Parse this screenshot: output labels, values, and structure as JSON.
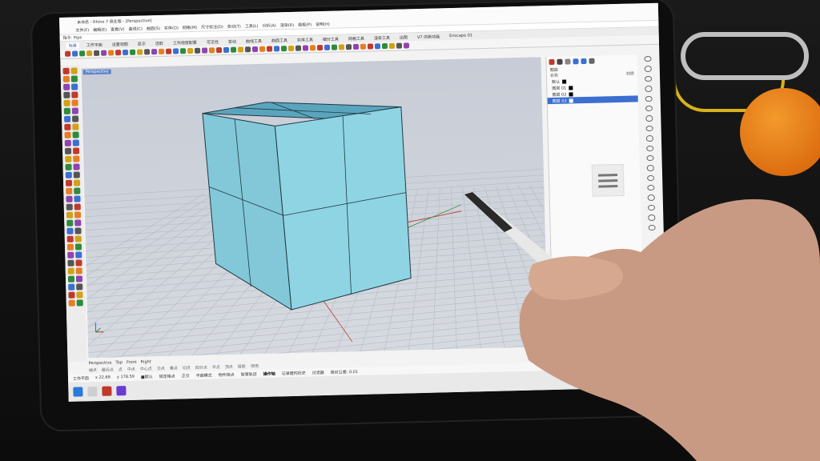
{
  "window_title": "未命名 - Rhino 7 商业版 - [Perspective]",
  "menu_items": [
    "文件(F)",
    "编辑(E)",
    "查看(V)",
    "曲线(C)",
    "曲面(S)",
    "实体(O)",
    "网格(M)",
    "尺寸标注(D)",
    "变动(T)",
    "工具(L)",
    "分析(A)",
    "渲染(R)",
    "面板(P)",
    "说明(H)"
  ],
  "command_line": "指令: Pipe",
  "tabs": [
    "标准",
    "工作平面",
    "设置视图",
    "显示",
    "选取",
    "工作视窗配置",
    "可见性",
    "变动",
    "曲线工具",
    "曲面工具",
    "实体工具",
    "细分工具",
    "网格工具",
    "渲染工具",
    "出图",
    "V7 的新功能",
    "Enscape 01"
  ],
  "active_tab_index": 0,
  "viewport_label": "Perspective",
  "view_tabs": [
    "Perspective",
    "Top",
    "Front",
    "Right"
  ],
  "osnap_items": [
    "端点",
    "最近点",
    "点",
    "中点",
    "中心点",
    "交点",
    "垂点",
    "切点",
    "四分点",
    "节点",
    "顶点",
    "投影",
    "停用"
  ],
  "status": {
    "cplane": "工作平面",
    "x": "x 22.68",
    "y": "y 178.59",
    "layer": "■默认",
    "items": [
      "锁定格点",
      "正交",
      "平面模式",
      "物件锁点",
      "智慧轨迹",
      "操作轴",
      "记录建构历史",
      "过滤器",
      "绝对公差: 0.01"
    ],
    "active_index": 5
  },
  "layers_panel": {
    "title": "图层",
    "header_name": "名称",
    "header_material": "材质",
    "rows": [
      {
        "name": "默认",
        "selected": false
      },
      {
        "name": "图层 01",
        "selected": false
      },
      {
        "name": "图层 02",
        "selected": false
      },
      {
        "name": "图层 03",
        "selected": true
      }
    ]
  },
  "colors": {
    "cube": "#8ed3e2",
    "cube_dark": "#6fb8c9",
    "cube_edge": "#1e3a45",
    "selected_layer": "#3b6fd1",
    "viewport": "#cdd2da"
  }
}
